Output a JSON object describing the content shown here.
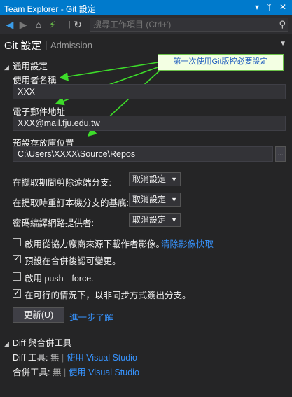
{
  "window": {
    "title": "Team Explorer - Git 設定",
    "pin": "📌",
    "close": "✕"
  },
  "toolbar": {
    "search_placeholder": "搜尋工作項目 (Ctrl+')"
  },
  "header": {
    "title": "Git 設定",
    "separator": "|",
    "subtitle": "Admission"
  },
  "general": {
    "title": "通用設定",
    "username_label": "使用者名稱",
    "username_value": "XXX",
    "email_label": "電子郵件地址",
    "email_value": "XXX@mail.fju.edu.tw",
    "repo_label": "預設存放庫位置",
    "repo_value": "C:\\Users\\XXXX\\Source\\Repos",
    "browse_label": "...",
    "prune_label": "在擷取期間剪除遠端分支:",
    "prune_value": "取消設定",
    "rebase_label": "在提取時重訂本機分支的基底:",
    "rebase_value": "取消設定",
    "crypto_label": "密碼編譯網路提供者:",
    "crypto_value": "取消設定",
    "avatar_label": "啟用從協力廠商來源下載作者影像。",
    "avatar_checked": false,
    "clear_cache_link": "清除影像快取",
    "commit_label": "預設在合併後認可變更。",
    "commit_checked": true,
    "force_label": "啟用 push --force.",
    "force_checked": false,
    "async_label": "在可行的情況下，以非同步方式簽出分支。",
    "async_checked": true,
    "update_button": "更新(U)",
    "learn_more_link": "進一步了解"
  },
  "diff": {
    "title": "Diff 與合併工具",
    "diff_label": "Diff 工具:",
    "diff_value": "無",
    "diff_link": "使用 Visual Studio",
    "merge_label": "合併工具:",
    "merge_value": "無",
    "merge_link": "使用 Visual Studio",
    "separator": "|"
  },
  "annotation": {
    "text": "第一次使用Git版控必要設定"
  },
  "colors": {
    "accent": "#007acc",
    "link": "#3794ff",
    "arrow": "#3ddc2a",
    "background": "#252526"
  }
}
